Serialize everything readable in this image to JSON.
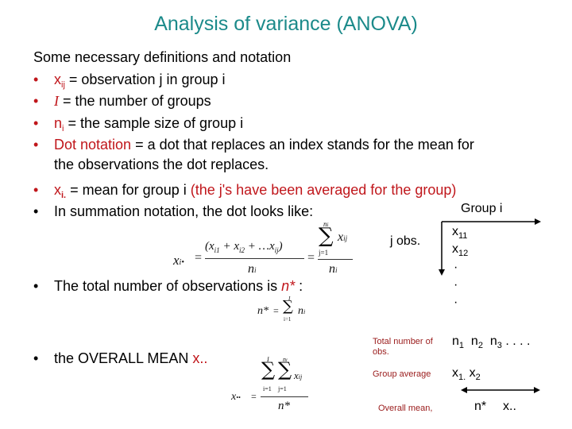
{
  "slide": {
    "title": "Analysis of variance (ANOVA)",
    "intro": "Some necessary definitions and notation",
    "bullets": {
      "b1_sym": "x",
      "b1_sub": "ij",
      "b1_text": " = observation j in group i",
      "b2_sym": "I",
      "b2_text": " = the number of groups",
      "b3_sym": "n",
      "b3_sub": "i",
      "b3_text": " = the sample size of group i",
      "b4_red": "Dot notation",
      "b4_text": " = a dot that replaces an index stands for the mean for",
      "b4_text2": "the observations the dot replaces.",
      "b5_sym": "x",
      "b5_sub": "i.",
      "b5_text": " = mean for group i ",
      "b5_red": "(the j's have been averaged for the group)",
      "b6_text": "In summation notation, the dot looks like:",
      "b7_text": "The total number of observations is ",
      "b7_red": "n*",
      "b7_tail": " :",
      "b8_text": "the OVERALL MEAN ",
      "b8_red": "x.."
    },
    "bullet_glyph": "•",
    "formulas": {
      "group_mean_lhs": "x",
      "group_mean_lhs_sub": "i•",
      "equals": "=",
      "group_mean_num": "(x",
      "group_mean_num_terms": "i1 + x i2 + …x ij)",
      "group_mean_den": "n",
      "group_mean_den_sub": "i",
      "sum_upper": "n",
      "sum_upper_sub": "i",
      "sum_lower": "j=1",
      "sum_term": "x",
      "sum_term_sub": "ij",
      "sigma": "∑",
      "nstar_lhs": "n*",
      "nstar_upper": "I",
      "nstar_lower": "i=1",
      "nstar_term": "n",
      "nstar_term_sub": "i",
      "overall_lhs": "x",
      "overall_lhs_sub": "••",
      "overall_upper1": "I",
      "overall_upper2": "n",
      "overall_upper2_sub": "i",
      "overall_lower1": "i=1",
      "overall_lower2": "j=1",
      "overall_term": "x",
      "overall_term_sub": "ij",
      "overall_den": "n*"
    },
    "diagram": {
      "group_label": "Group i",
      "j_obs_label": "j obs.",
      "x11": "x",
      "x11_sub": "11",
      "x12": "x",
      "x12_sub": "12",
      "dots": [
        "·",
        "·",
        "·"
      ],
      "row_total_label_1": "Total number of",
      "row_total_label_2": "obs.",
      "row_total_values": [
        {
          "sym": "n",
          "sub": "1"
        },
        {
          "sym": "n",
          "sub": "2"
        },
        {
          "sym": "n",
          "sub": "3"
        }
      ],
      "row_total_ellipsis": ". . . .",
      "row_avg_label": "Group average",
      "row_avg_values": [
        {
          "sym": "x",
          "sub": "1."
        },
        {
          "sym": "x",
          "sub": "2"
        }
      ],
      "row_overall_label": "Overall mean,",
      "row_overall_n": "n*",
      "row_overall_x": "x.."
    }
  }
}
